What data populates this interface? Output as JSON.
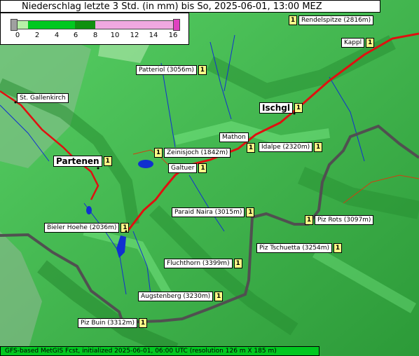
{
  "title": "Niederschlag letzte 3 Std. (in mm) bis So, 2025-06-01, 13:00 MEZ",
  "legend": {
    "ticks": [
      "0",
      "2",
      "4",
      "6",
      "8",
      "10",
      "12",
      "14",
      "16"
    ],
    "colors": {
      "no_data": "#a0a0a0",
      "band_0_2": "#b8f0a8",
      "band_2_8": "#00c820",
      "band_6_8": "#109010",
      "band_8_16": "#f0a8e0",
      "band_16": "#e040c0"
    }
  },
  "places": [
    {
      "name": "Rendelspitze (2816m)",
      "value": "1"
    },
    {
      "name": "Kappl",
      "value": "1"
    },
    {
      "name": "Patteriol (3056m)",
      "value": "1"
    },
    {
      "name": "St. Gallenkirch",
      "value": ""
    },
    {
      "name": "Ischgl",
      "value": "1"
    },
    {
      "name": "Mathon",
      "value": ""
    },
    {
      "name": "Idalpe (2320m)",
      "value": "1"
    },
    {
      "name": "Zeinisjoch (1842m)",
      "value": "1"
    },
    {
      "name": "Partenen",
      "value": "1"
    },
    {
      "name": "Galtuer",
      "value": "1"
    },
    {
      "name": "Paraid Naira (3015m)",
      "value": "1"
    },
    {
      "name": "Piz Rots (3097m)",
      "value": "1"
    },
    {
      "name": "Bieler Hoehe (2036m)",
      "value": "1"
    },
    {
      "name": "Piz Tschuetta (3254m)",
      "value": "1"
    },
    {
      "name": "Fluchthorn (3399m)",
      "value": "1"
    },
    {
      "name": "Augstenberg (3230m)",
      "value": "1"
    },
    {
      "name": "Piz Buin (3312m)",
      "value": "1"
    },
    {
      "name": "Mathon-marker",
      "value": "1"
    }
  ],
  "footer": "GFS-based MetGIS Fcst, initialized 2025-06-01, 06:00 UTC  (resolution 126 m X 185 m)",
  "colors": {
    "terrain_light": "#5fd86a",
    "terrain_dark": "#2a8f35",
    "road": "#e01010",
    "border": "#505050",
    "river": "#1030d0"
  }
}
